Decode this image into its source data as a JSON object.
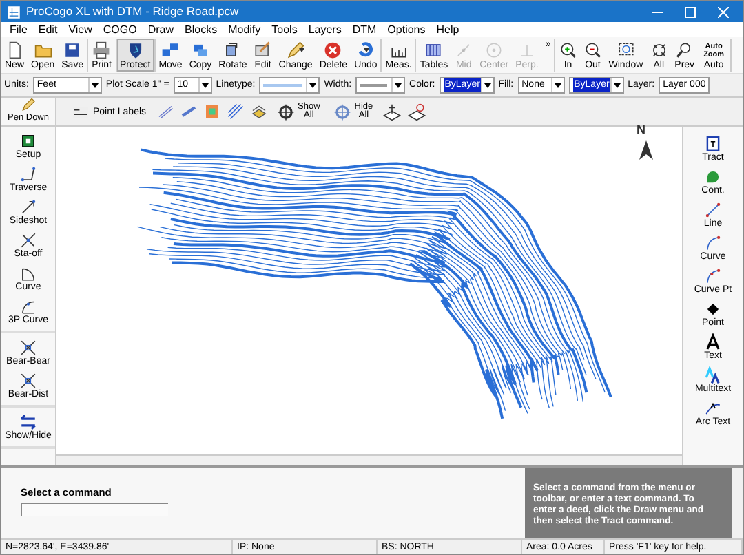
{
  "window": {
    "title": "ProCogo XL with DTM - Ridge Road.pcw"
  },
  "menu": [
    "File",
    "Edit",
    "View",
    "COGO",
    "Draw",
    "Blocks",
    "Modify",
    "Tools",
    "Layers",
    "DTM",
    "Options",
    "Help"
  ],
  "toolbar": [
    [
      {
        "label": "New",
        "kind": "button",
        "disabled": false,
        "pressed": false
      },
      {
        "label": "Open",
        "kind": "button",
        "disabled": false,
        "pressed": false
      },
      {
        "label": "Save",
        "kind": "button",
        "disabled": false,
        "pressed": false
      }
    ],
    [
      {
        "label": "Print",
        "kind": "button",
        "disabled": false,
        "pressed": false
      }
    ],
    [
      {
        "label": "Protect",
        "kind": "button",
        "disabled": false,
        "pressed": true
      }
    ],
    [
      {
        "label": "Move",
        "kind": "button",
        "disabled": false,
        "pressed": false
      },
      {
        "label": "Copy",
        "kind": "button",
        "disabled": false,
        "pressed": false
      },
      {
        "label": "Rotate",
        "kind": "button",
        "disabled": false,
        "pressed": false
      },
      {
        "label": "Edit",
        "kind": "button",
        "disabled": false,
        "pressed": false
      },
      {
        "label": "Change",
        "kind": "dropdown",
        "disabled": false,
        "pressed": false
      },
      {
        "label": "Delete",
        "kind": "button",
        "disabled": false,
        "pressed": false
      },
      {
        "label": "Undo",
        "kind": "dropdown",
        "disabled": false,
        "pressed": false
      }
    ],
    [
      {
        "label": "Meas.",
        "kind": "button",
        "disabled": false,
        "pressed": false
      }
    ],
    [
      {
        "label": "Tables",
        "kind": "button",
        "disabled": false,
        "pressed": false
      },
      {
        "label": "Mid",
        "kind": "button",
        "disabled": true,
        "pressed": false
      },
      {
        "label": "Center",
        "kind": "button",
        "disabled": true,
        "pressed": false
      },
      {
        "label": "Perp.",
        "kind": "button",
        "disabled": true,
        "pressed": false
      },
      {
        "label": "»",
        "kind": "overflow",
        "disabled": false,
        "pressed": false
      }
    ],
    [
      {
        "label": "In",
        "kind": "button",
        "disabled": false,
        "pressed": false
      },
      {
        "label": "Out",
        "kind": "button",
        "disabled": false,
        "pressed": false
      },
      {
        "label": "Window",
        "kind": "button",
        "disabled": false,
        "pressed": false
      },
      {
        "label": "All",
        "kind": "button",
        "disabled": false,
        "pressed": false
      },
      {
        "label": "Prev",
        "kind": "button",
        "disabled": false,
        "pressed": false
      },
      {
        "label": "Auto",
        "kind": "button",
        "disabled": false,
        "pressed": false,
        "icon_text": "Auto Zoom"
      }
    ]
  ],
  "properties": {
    "units": {
      "label": "Units:",
      "value": "Feet"
    },
    "plot_scale": {
      "label": "Plot Scale 1\" =",
      "value": "10"
    },
    "linetype": {
      "label": "Linetype:"
    },
    "width": {
      "label": "Width:"
    },
    "color": {
      "label": "Color:",
      "value": "ByLayer"
    },
    "fill": {
      "label": "Fill:",
      "value": "None",
      "value_2": "ByLayer"
    },
    "layer": {
      "label": "Layer:",
      "value": "Layer 000"
    }
  },
  "pen_down": "Pen Down",
  "point_toolbar": {
    "point_labels": "Point Labels",
    "show_all": [
      "Show",
      "All"
    ],
    "hide_all": [
      "Hide",
      "All"
    ]
  },
  "left_palette": [
    [
      "Setup",
      "Traverse",
      "Sideshot",
      "Sta-off",
      "Curve",
      "3P Curve"
    ],
    [
      "Bear-Bear",
      "Bear-Dist"
    ],
    [
      "Show/Hide"
    ]
  ],
  "right_palette": [
    "Tract",
    "Cont.",
    "Line",
    "Curve",
    "Curve Pt",
    "Point",
    "Text",
    "Multitext",
    "Arc Text"
  ],
  "north_arrow": "N",
  "command": {
    "prompt": "Select a command",
    "help": "Select a command from the menu or toolbar, or enter a text command. To enter a deed, click the Draw menu and then select the Tract command."
  },
  "status_bar": [
    "N=2823.64',  E=3439.86'",
    "IP: None",
    "BS: NORTH",
    "Area: 0.0 Acres",
    "Press 'F1' key  for help."
  ]
}
